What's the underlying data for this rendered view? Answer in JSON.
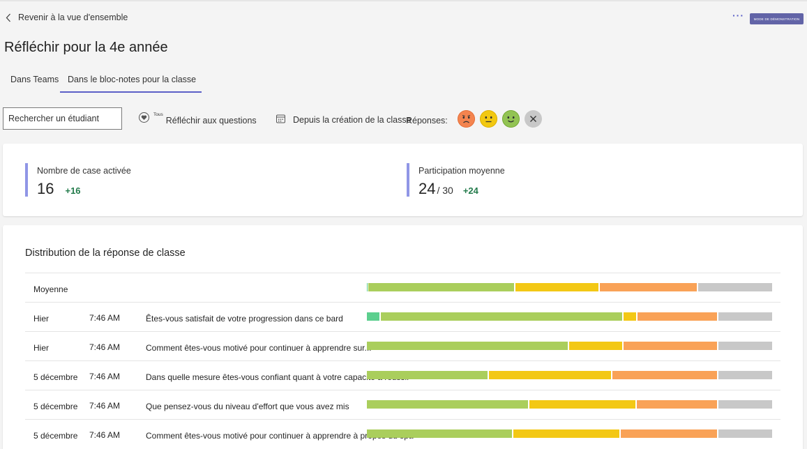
{
  "header": {
    "back_label": "Revenir à la vue d'ensemble",
    "more_label": "···",
    "demo_badge": "MODE DE DÉMONSTRATION"
  },
  "title": "Réfléchir pour la 4e année",
  "tabs": [
    {
      "label": "Dans Teams",
      "selected": false
    },
    {
      "label": "Dans le bloc-notes pour la classe",
      "selected": true
    }
  ],
  "filters": {
    "search_value": "Rechercher un étudiant",
    "questions_prefix": "Tous",
    "questions_label": "Réfléchir aux questions",
    "date_label": "Depuis la création de la classe",
    "responses_label": "Réponses:"
  },
  "response_emojis": [
    {
      "icon": "sad-face-icon",
      "color": "#f4844f"
    },
    {
      "icon": "neutral-face-icon",
      "color": "#f2c811"
    },
    {
      "icon": "happy-face-icon",
      "color": "#92c353"
    },
    {
      "icon": "close-icon",
      "color": "#c8c8c8"
    }
  ],
  "stats": [
    {
      "label": "Nombre de case activée",
      "value": "16",
      "of": "",
      "delta": "+16"
    },
    {
      "label": "Participation moyenne",
      "value": "24",
      "of": "/ 30",
      "delta": "+24"
    }
  ],
  "distribution": {
    "title": "Distribution de la réponse de classe",
    "colors": {
      "very_happy": "#5ccf8e",
      "happy": "#aace5c",
      "neutral": "#f3c815",
      "sad": "#f9a257",
      "none": "#c8c8c8"
    },
    "rows": [
      {
        "date": "Moyenne",
        "time": "",
        "question": "",
        "fractions": {
          "very_happy": 0.004,
          "happy": 0.361,
          "neutral": 0.208,
          "sad": 0.241,
          "none": 0.186
        }
      },
      {
        "date": "Hier",
        "time": "7:46 AM",
        "question": "Êtes-vous satisfait de votre progression dans ce bard",
        "fractions": {
          "very_happy": 0.035,
          "happy": 0.596,
          "neutral": 0.035,
          "sad": 0.198,
          "none": 0.136
        }
      },
      {
        "date": "Hier",
        "time": "7:46 AM",
        "question": "Comment êtes-vous motivé pour continuer à apprendre sur...",
        "fractions": {
          "very_happy": 0.0,
          "happy": 0.497,
          "neutral": 0.135,
          "sad": 0.233,
          "none": 0.135
        }
      },
      {
        "date": "5 décembre",
        "time": "7:46 AM",
        "question": "Dans quelle mesure êtes-vous confiant quant à votre capacité à réussir",
        "fractions": {
          "very_happy": 0.0,
          "happy": 0.301,
          "neutral": 0.302,
          "sad": 0.262,
          "none": 0.135
        }
      },
      {
        "date": "5 décembre",
        "time": "7:46 AM",
        "question": "Que pensez-vous du niveau d'effort que vous avez mis",
        "fractions": {
          "very_happy": 0.0,
          "happy": 0.399,
          "neutral": 0.265,
          "sad": 0.2,
          "none": 0.136
        }
      },
      {
        "date": "5 décembre",
        "time": "7:46 AM",
        "question": "Comment êtes-vous motivé pour continuer à apprendre à propos du spa",
        "fractions": {
          "very_happy": 0.0,
          "happy": 0.36,
          "neutral": 0.265,
          "sad": 0.24,
          "none": 0.135
        }
      }
    ]
  }
}
